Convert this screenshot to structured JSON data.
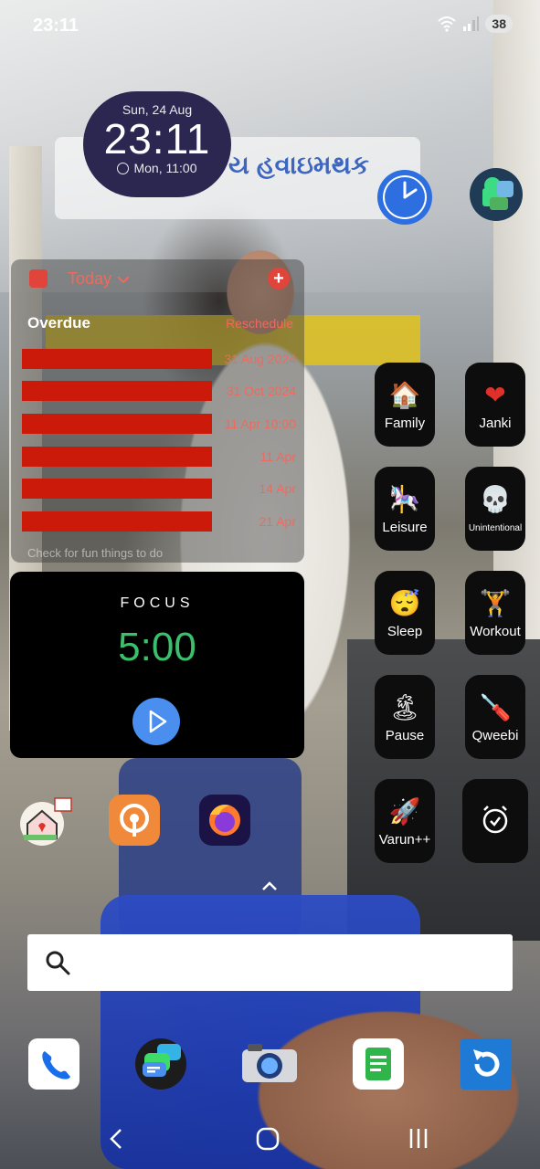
{
  "status_bar": {
    "time": "23:11",
    "battery": "38"
  },
  "clock_widget": {
    "date": "Sun, 24 Aug",
    "time": "23:11",
    "next_alarm": "Mon, 11:00"
  },
  "tasks_widget": {
    "filter": "Today",
    "section": "Overdue",
    "reschedule": "Reschedule",
    "tasks": [
      {
        "title": "[redacted]",
        "date": "31 Aug 2024"
      },
      {
        "title": "[redacted]",
        "date": "31 Oct 2024"
      },
      {
        "title": "[redacted]",
        "date": "11 Apr 10:00"
      },
      {
        "title": "[redacted]",
        "date": "11 Apr"
      },
      {
        "title": "[redacted]",
        "date": "14 Apr"
      },
      {
        "title": "[redacted]",
        "date": "21 Apr"
      }
    ],
    "footer": "Check for fun things to do"
  },
  "focus_widget": {
    "title": "FOCUS",
    "timer": "5:00"
  },
  "shortcuts": [
    {
      "label": "Family",
      "icon": "house-icon"
    },
    {
      "label": "Janki",
      "icon": "heart-icon"
    },
    {
      "label": "Leisure",
      "icon": "carousel-horse-icon"
    },
    {
      "label": "Unintentional",
      "icon": "skull-icon"
    },
    {
      "label": "Sleep",
      "icon": "sleeping-face-icon"
    },
    {
      "label": "Workout",
      "icon": "weightlifter-icon"
    },
    {
      "label": "Pause",
      "icon": "island-icon"
    },
    {
      "label": "Qweebi",
      "icon": "screwdriver-icon"
    },
    {
      "label": "Varun++",
      "icon": "rocket-icon"
    },
    {
      "label": "",
      "icon": "alarm-check-icon"
    }
  ],
  "background_text": {
    "banner": "ય હવાઇમથક"
  },
  "search": {
    "placeholder": ""
  },
  "colors": {
    "accent_red": "#e0443a",
    "focus_green": "#3ac06a",
    "clock_widget_bg": "#2c2750"
  }
}
